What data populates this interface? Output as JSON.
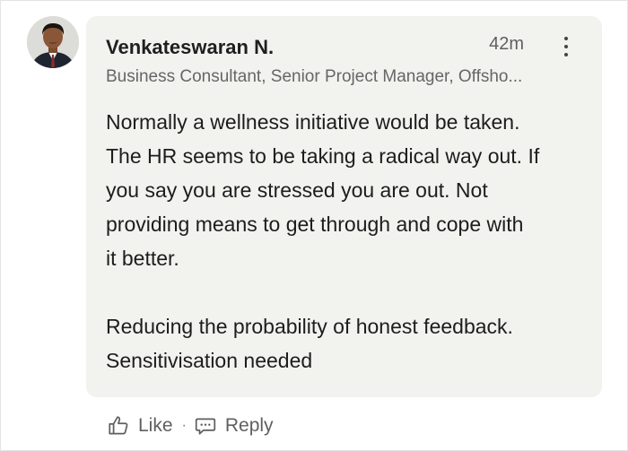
{
  "comment": {
    "author_name": "Venkateswaran N.",
    "author_headline": "Business Consultant, Senior Project Manager, Offsho...",
    "timestamp": "42m",
    "body_paragraphs": [
      "Normally a wellness initiative would be taken.\nThe HR seems to be taking a radical way out. If\nyou say you are stressed you are out. Not\nproviding means to get through and cope with\nit better.",
      "Reducing the probability of honest feedback.\nSensitivisation needed"
    ]
  },
  "actions": {
    "like_label": "Like",
    "separator": "·",
    "reply_label": "Reply"
  },
  "icons": {
    "like": "thumbs-up-icon",
    "reply": "speech-bubble-icon",
    "more": "vertical-ellipsis-icon"
  },
  "colors": {
    "bubble_background": "#f2f2ef",
    "primary_text": "#1d1d1d",
    "secondary_text": "#5f5f5f"
  }
}
